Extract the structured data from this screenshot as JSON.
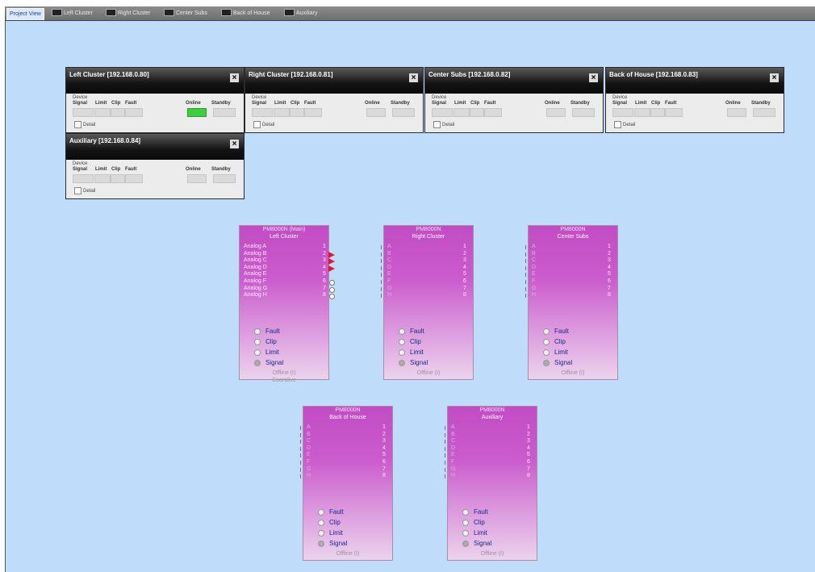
{
  "tabs": [
    {
      "label": "Project View",
      "active": true
    },
    {
      "label": "Left Cluster"
    },
    {
      "label": "Right Cluster"
    },
    {
      "label": "Center Subs"
    },
    {
      "label": "Back of House"
    },
    {
      "label": "Auxiliary"
    }
  ],
  "panel_columns": {
    "device": "Device",
    "signal": "Signal",
    "limit": "Limit",
    "clip": "Clip",
    "fault": "Fault",
    "online": "Online",
    "standby": "Standby",
    "detail": "Detail"
  },
  "panels": [
    {
      "title": "Left Cluster  [192.168.0.80]",
      "online": true
    },
    {
      "title": "Right Cluster  [192.168.0.81]",
      "online": false
    },
    {
      "title": "Center Subs  [192.168.0.82]",
      "online": false
    },
    {
      "title": "Back of House  [192.168.0.83]",
      "online": false
    },
    {
      "title": "Auxiliary  [192.168.0.84]",
      "online": false
    }
  ],
  "status_labels": [
    "Fault",
    "Clip",
    "Limit",
    "Signal"
  ],
  "devices": [
    {
      "model": "PM8000N (Main)",
      "name": "Left Cluster",
      "channels": [
        "Analog A",
        "Analog B",
        "Analog C",
        "Analog D",
        "Analog E",
        "Analog F",
        "Analog G",
        "Analog H"
      ],
      "outputs": [
        "1",
        "2",
        "3",
        "4",
        "5",
        "6",
        "7",
        "8"
      ],
      "status": "Offline (I)",
      "extra": "Cooralive"
    },
    {
      "model": "PM8000N",
      "name": "Right Cluster",
      "channels": [
        "A",
        "B",
        "C",
        "D",
        "E",
        "F",
        "G",
        "H"
      ],
      "outputs": [
        "1",
        "2",
        "3",
        "4",
        "5",
        "6",
        "7",
        "8"
      ],
      "status": "Offline (I)",
      "extra": ""
    },
    {
      "model": "PM8000N",
      "name": "Center Subs",
      "channels": [
        "A",
        "B",
        "C",
        "D",
        "E",
        "F",
        "G",
        "H"
      ],
      "outputs": [
        "1",
        "2",
        "3",
        "4",
        "5",
        "6",
        "7",
        "8"
      ],
      "status": "Offline (I)",
      "extra": ""
    },
    {
      "model": "PM8000N",
      "name": "Back of House",
      "channels": [
        "A",
        "B",
        "C",
        "D",
        "E",
        "F",
        "G",
        "H"
      ],
      "outputs": [
        "1",
        "2",
        "3",
        "4",
        "5",
        "6",
        "7",
        "8"
      ],
      "status": "Offline (I)",
      "extra": ""
    },
    {
      "model": "PM8000N",
      "name": "Auxiliary",
      "channels": [
        "A",
        "B",
        "C",
        "D",
        "E",
        "F",
        "G",
        "H"
      ],
      "outputs": [
        "1",
        "2",
        "3",
        "4",
        "5",
        "6",
        "7",
        "8"
      ],
      "status": "Offline (I)",
      "extra": ""
    }
  ],
  "colors": {
    "canvas": "#bfddfb",
    "device": "#c24cc4",
    "online_green": "#3ecf3e",
    "arrow_red": "#e0182a"
  }
}
